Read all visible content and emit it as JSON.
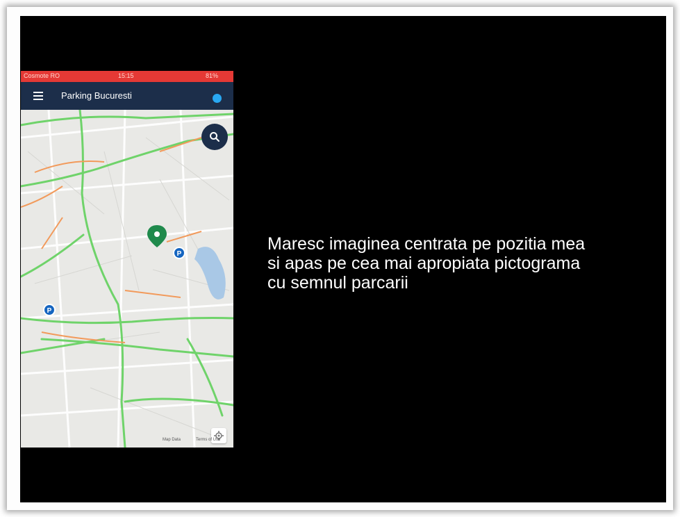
{
  "statusbar": {
    "carrier": "Cosmote RO",
    "time": "15:15",
    "battery": "81%"
  },
  "appbar": {
    "title": "Parking Bucuresti"
  },
  "map": {
    "labels": {
      "pin1": "P",
      "pin2": "P",
      "map_data": "Map Data",
      "terms": "Terms of Use"
    },
    "colors": {
      "traffic_green": "#6fd36a",
      "traffic_orange": "#f29a5b",
      "location_pin": "#1f8a4c",
      "parking_pin": "#1565c0"
    }
  },
  "caption": {
    "line1": "Maresc imaginea centrata pe pozitia mea",
    "line2": "si apas pe cea mai apropiata pictograma",
    "line3": "cu semnul parcarii"
  }
}
